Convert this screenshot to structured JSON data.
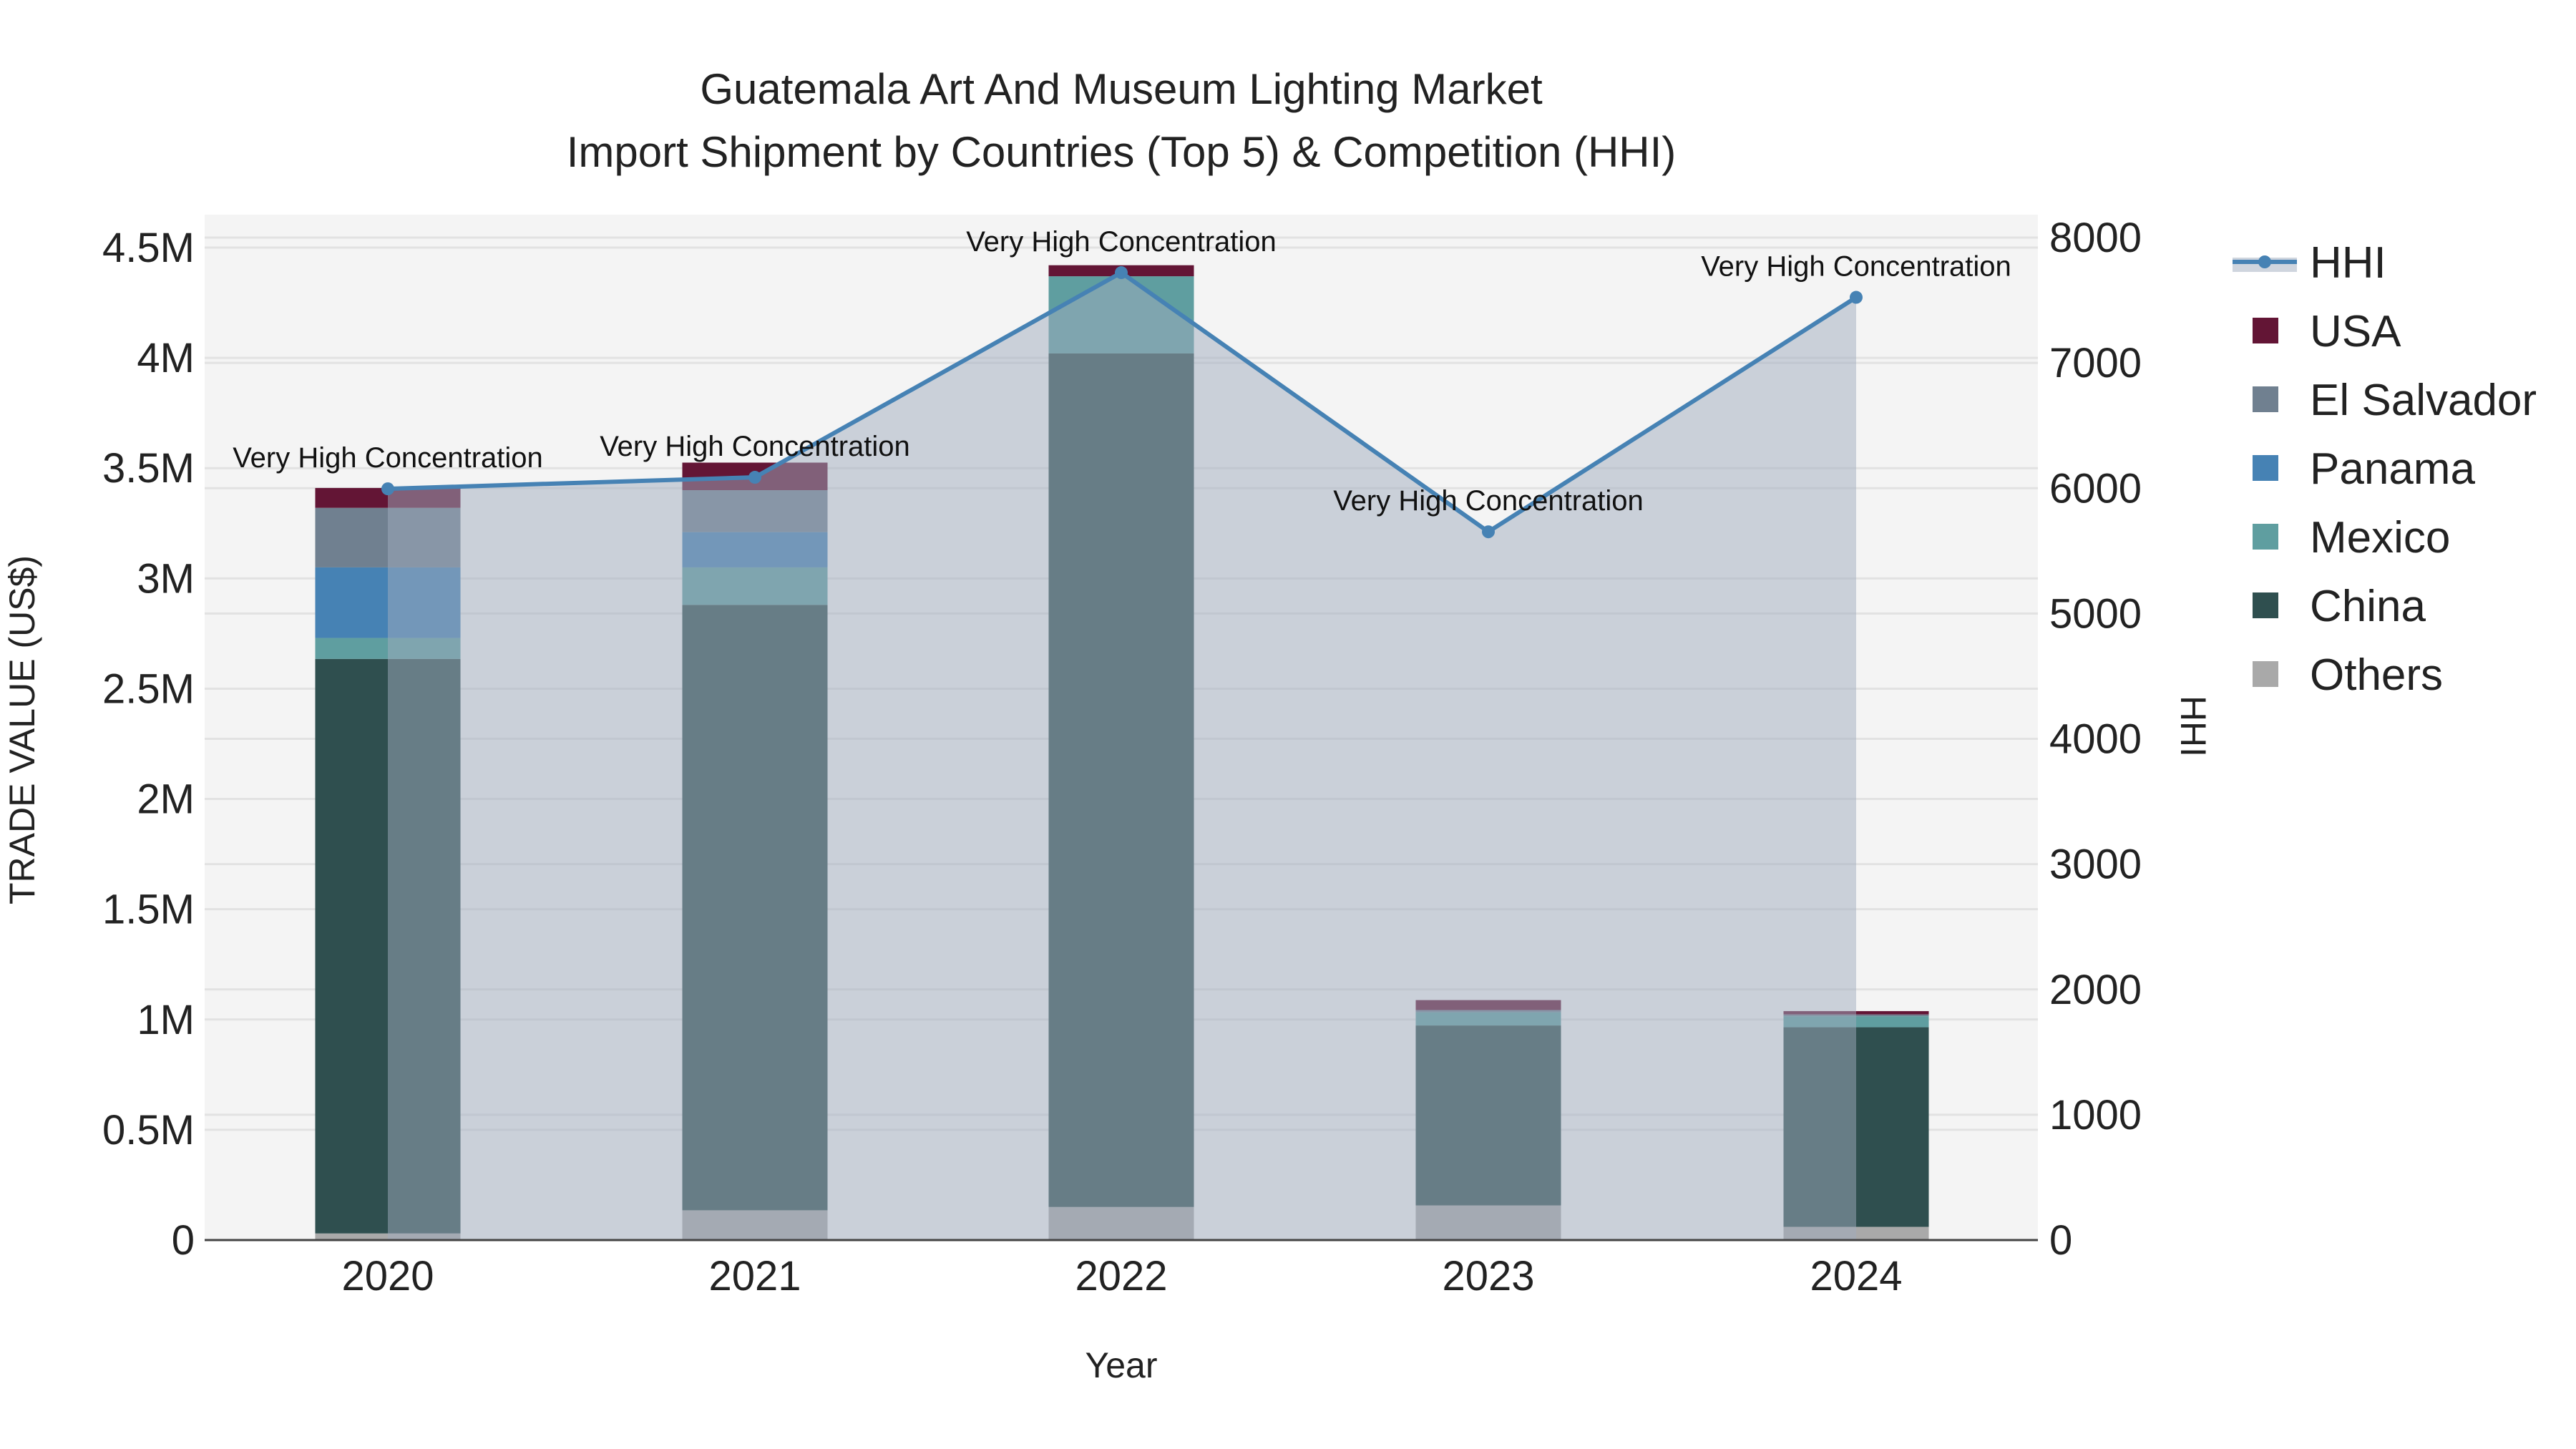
{
  "chart_data": {
    "type": "bar",
    "title_line1": "Guatemala Art And Museum Lighting Market",
    "title_line2": "Import Shipment by Countries (Top 5) & Competition (HHI)",
    "xlabel": "Year",
    "ylabel": "TRADE VALUE (US$)",
    "y2label": "HHI",
    "categories": [
      "2020",
      "2021",
      "2022",
      "2023",
      "2024"
    ],
    "ylim": [
      0,
      4600000
    ],
    "y_ticks": [
      0,
      500000,
      1000000,
      1500000,
      2000000,
      2500000,
      3000000,
      3500000,
      4000000,
      4500000
    ],
    "y_tick_labels": [
      "0",
      "0.5M",
      "1M",
      "1.5M",
      "2M",
      "2.5M",
      "3M",
      "3.5M",
      "4M",
      "4.5M"
    ],
    "y2lim": [
      0,
      8200
    ],
    "y2_ticks": [
      0,
      1000,
      2000,
      3000,
      4000,
      5000,
      6000,
      7000,
      8000
    ],
    "y2_tick_labels": [
      "0",
      "1000",
      "2000",
      "3000",
      "4000",
      "5000",
      "6000",
      "7000",
      "8000"
    ],
    "series": [
      {
        "name": "Others",
        "color": "#A9A9A9",
        "values": [
          30000,
          135000,
          150000,
          157000,
          60000
        ]
      },
      {
        "name": "China",
        "color": "#2F4F4F",
        "values": [
          2605000,
          2745000,
          3870000,
          816000,
          905000
        ]
      },
      {
        "name": "Mexico",
        "color": "#5F9EA0",
        "values": [
          95000,
          170000,
          350000,
          60000,
          50000
        ]
      },
      {
        "name": "Panama",
        "color": "#4682B4",
        "values": [
          320000,
          160000,
          0,
          0,
          0
        ]
      },
      {
        "name": "El Salvador",
        "color": "#708090",
        "values": [
          270000,
          190000,
          0,
          10000,
          8000
        ]
      },
      {
        "name": "USA",
        "color": "#631535",
        "values": [
          90000,
          125000,
          50000,
          45000,
          15000
        ]
      }
    ],
    "hhi": {
      "name": "HHI",
      "color": "#4682B4",
      "values": [
        5995,
        6087,
        7720,
        5652,
        7523
      ],
      "annotations": [
        "Very High Concentration",
        "Very High Concentration",
        "Very High Concentration",
        "Very High Concentration",
        "Very High Concentration"
      ]
    },
    "legend_order": [
      "HHI",
      "USA",
      "El Salvador",
      "Panama",
      "Mexico",
      "China",
      "Others"
    ],
    "legend_position": "right",
    "grid": true
  }
}
